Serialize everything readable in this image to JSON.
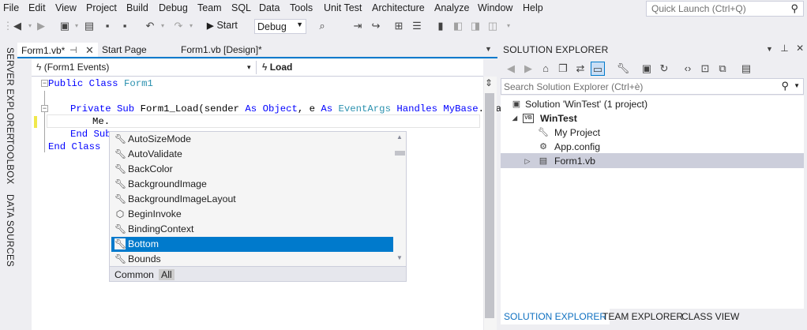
{
  "menu": [
    "File",
    "Edit",
    "View",
    "Project",
    "Build",
    "Debug",
    "Team",
    "SQL",
    "Data",
    "Tools",
    "Unit Test",
    "Architecture",
    "Analyze",
    "Window",
    "Help"
  ],
  "quick_launch": {
    "placeholder": "Quick Launch (Ctrl+Q)"
  },
  "toolbar": {
    "start_label": "Start",
    "configuration": "Debug"
  },
  "side_tabs": [
    "SERVER EXPLORER",
    "TOOLBOX",
    "DATA SOURCES"
  ],
  "doc_tabs": [
    {
      "label": "Form1.vb*",
      "active": true
    },
    {
      "label": "Start Page",
      "active": false
    },
    {
      "label": "Form1.vb [Design]*",
      "active": false
    }
  ],
  "editor_nav": {
    "object": "(Form1 Events)",
    "member": "Load"
  },
  "code": {
    "line1": {
      "kw": "Public Class",
      "name": "Form1"
    },
    "line3": {
      "kw1": "Private Sub",
      "text1": " Form1_Load(sender ",
      "kw2": "As",
      "text2": " ",
      "kw3": "Object",
      "text3": ", e ",
      "kw4": "As",
      "text4": " ",
      "ty1": "EventArgs",
      "text5": " ",
      "kw5": "Handles",
      "text6": " ",
      "kw6": "MyBase",
      "text7": ".Loa"
    },
    "line4": "Me.",
    "line5": "End Sub",
    "line6": "End Class"
  },
  "intellisense": {
    "items": [
      {
        "label": "AutoSizeMode",
        "icon": "property-icon"
      },
      {
        "label": "AutoValidate",
        "icon": "property-icon"
      },
      {
        "label": "BackColor",
        "icon": "property-icon"
      },
      {
        "label": "BackgroundImage",
        "icon": "property-icon"
      },
      {
        "label": "BackgroundImageLayout",
        "icon": "property-icon"
      },
      {
        "label": "BeginInvoke",
        "icon": "method-icon"
      },
      {
        "label": "BindingContext",
        "icon": "property-icon"
      },
      {
        "label": "Bottom",
        "icon": "property-icon",
        "selected": true
      },
      {
        "label": "Bounds",
        "icon": "property-icon"
      }
    ],
    "tabs": [
      "Common",
      "All"
    ]
  },
  "solution_explorer": {
    "title": "SOLUTION EXPLORER",
    "search_placeholder": "Search Solution Explorer (Ctrl+è)",
    "tree": [
      {
        "label": "Solution 'WinTest' (1 project)",
        "icon": "solution-icon",
        "bold": false
      },
      {
        "label": "WinTest",
        "icon": "vb-project-icon",
        "bold": true
      },
      {
        "label": "My Project",
        "icon": "wrench-icon",
        "bold": false
      },
      {
        "label": "App.config",
        "icon": "config-icon",
        "bold": false
      },
      {
        "label": "Form1.vb",
        "icon": "form-icon",
        "bold": false,
        "selected": true
      }
    ],
    "bottom_tabs": [
      "SOLUTION EXPLORER",
      "TEAM EXPLORER",
      "CLASS VIEW"
    ]
  },
  "colors": {
    "accent": "#007acc",
    "selection": "#cccedb",
    "keyword": "#0000ff",
    "type": "#2b91af"
  }
}
